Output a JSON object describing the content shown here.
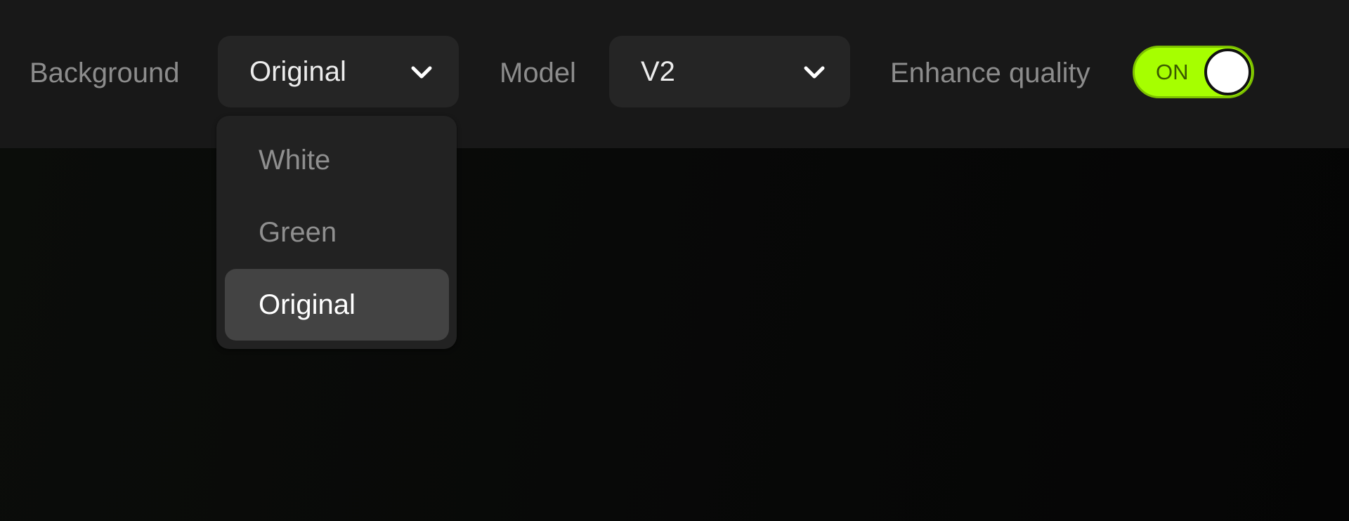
{
  "toolbar": {
    "background": {
      "label": "Background",
      "selected": "Original",
      "menu_open": true,
      "options": [
        {
          "label": "White",
          "selected": false
        },
        {
          "label": "Green",
          "selected": false
        },
        {
          "label": "Original",
          "selected": true
        }
      ]
    },
    "model": {
      "label": "Model",
      "selected": "V2"
    },
    "enhance_quality": {
      "label": "Enhance quality",
      "state_text": "ON",
      "enabled": true
    }
  },
  "icons": {
    "dropdown_chevron": "chevron-down-icon"
  },
  "colors": {
    "accent": "#a6ff00",
    "toolbar_bg": "#181818",
    "select_bg": "#252525",
    "menu_bg": "#222222",
    "menu_selected_bg": "#434343",
    "canvas_bg": "#070807"
  }
}
